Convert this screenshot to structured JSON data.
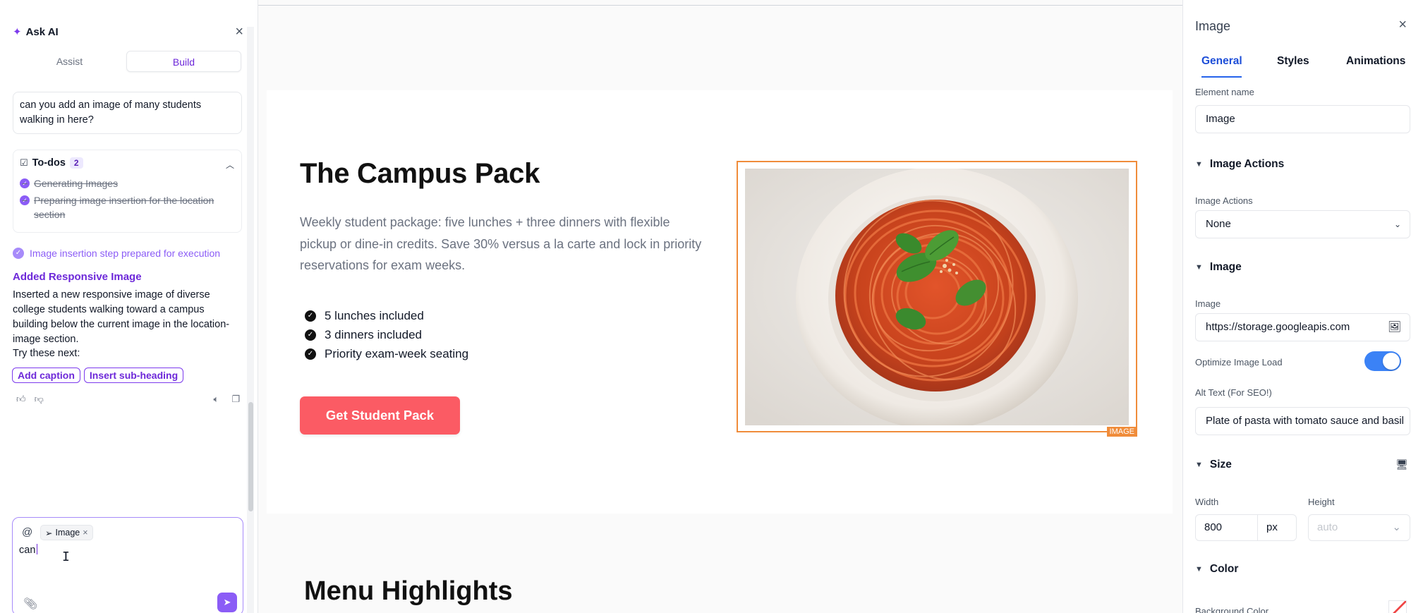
{
  "ai_panel": {
    "title": "Ask AI",
    "tabs": [
      {
        "label": "Assist",
        "active": false
      },
      {
        "label": "Build",
        "active": true
      }
    ],
    "user_message": "can you add an image of many students walking in here?",
    "todos": {
      "label": "To-dos",
      "count": "2",
      "items": [
        "Generating Images",
        "Preparing image insertion for the location section"
      ]
    },
    "status": "Image insertion step prepared for execution",
    "response_title": "Added Responsive Image",
    "response_body": "Inserted a new responsive image of diverse college students walking toward a campus building below the current image in the location-image section.",
    "try_next_label": "Try these next:",
    "suggestions": [
      "Add caption",
      "Insert sub-heading"
    ],
    "input": {
      "context_chip": "Image",
      "text": "can"
    }
  },
  "canvas": {
    "hero": {
      "title": "The Campus Pack",
      "description": "Weekly student package: five lunches + three dinners with flexible pickup or dine-in credits. Save 30% versus a la carte and lock in priority reservations for exam weeks.",
      "features": [
        "5 lunches included",
        "3 dinners included",
        "Priority exam-week seating"
      ],
      "cta_label": "Get Student Pack",
      "image_badge": "IMAGE"
    },
    "next_section_title": "Menu Highlights"
  },
  "inspector": {
    "title": "Image",
    "tabs": [
      {
        "label": "General",
        "active": true
      },
      {
        "label": "Styles",
        "active": false
      },
      {
        "label": "Animations",
        "active": false
      }
    ],
    "element_name_label": "Element name",
    "element_name_value": "Image",
    "image_actions_section": "Image Actions",
    "image_actions_label": "Image Actions",
    "image_actions_value": "None",
    "image_section": "Image",
    "image_label": "Image",
    "image_url": "https://storage.googleapis.com",
    "optimize_label": "Optimize Image Load",
    "optimize_on": true,
    "alt_label": "Alt Text (For SEO!)",
    "alt_value": "Plate of pasta with tomato sauce and basil",
    "size_section": "Size",
    "width_label": "Width",
    "width_value": "800",
    "width_unit": "px",
    "height_label": "Height",
    "height_value": "auto",
    "color_section": "Color",
    "background_label": "Background Color"
  },
  "colors": {
    "accent_purple": "#7c3aed",
    "cta_red": "#fb5b64",
    "selection_orange": "#f08c3a",
    "toggle_blue": "#3b82f6"
  }
}
